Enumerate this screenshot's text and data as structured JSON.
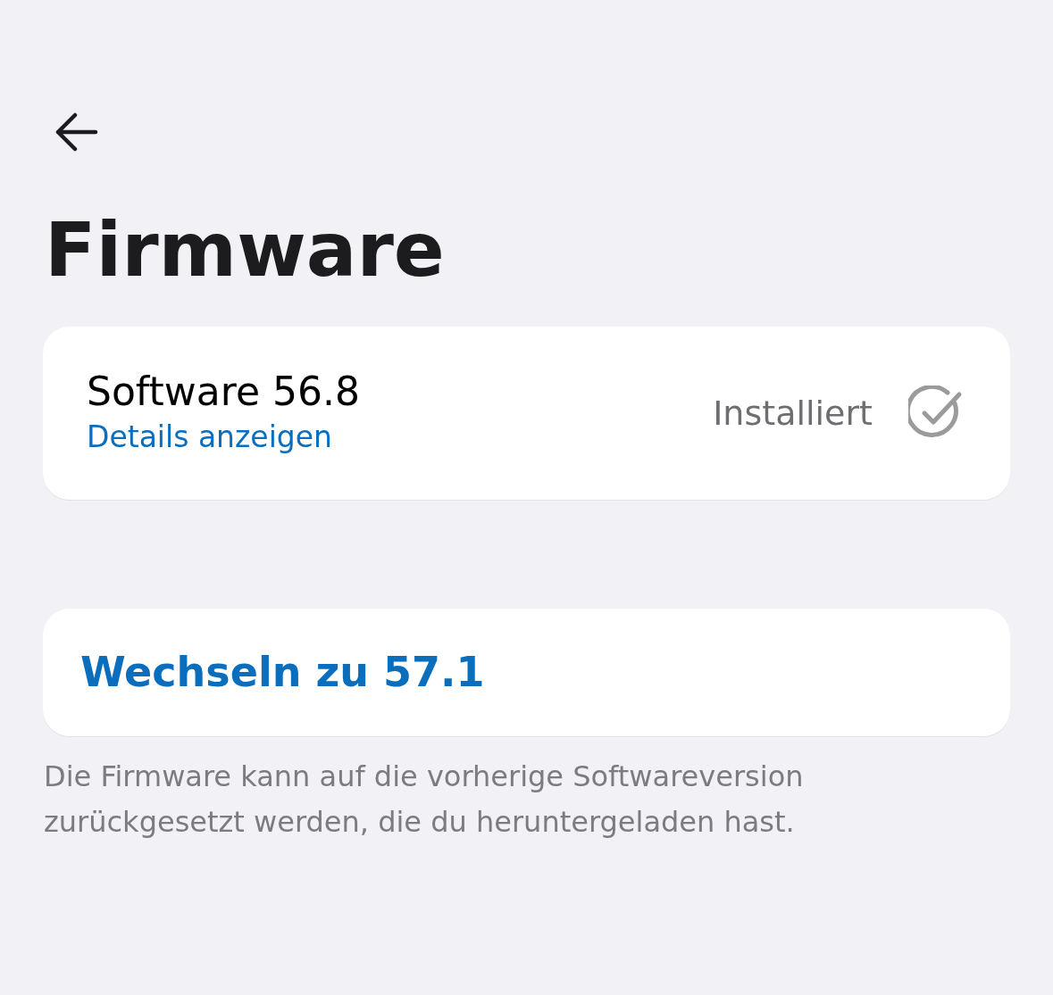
{
  "title": "Firmware",
  "current": {
    "name": "Software 56.8",
    "details_link": "Details anzeigen",
    "status": "Installiert",
    "installed": true
  },
  "switch_button": "Wechseln zu 57.1",
  "footnote": "Die Firmware kann auf die vorherige Softwareversion zurückgesetzt werden, die du heruntergeladen hast."
}
